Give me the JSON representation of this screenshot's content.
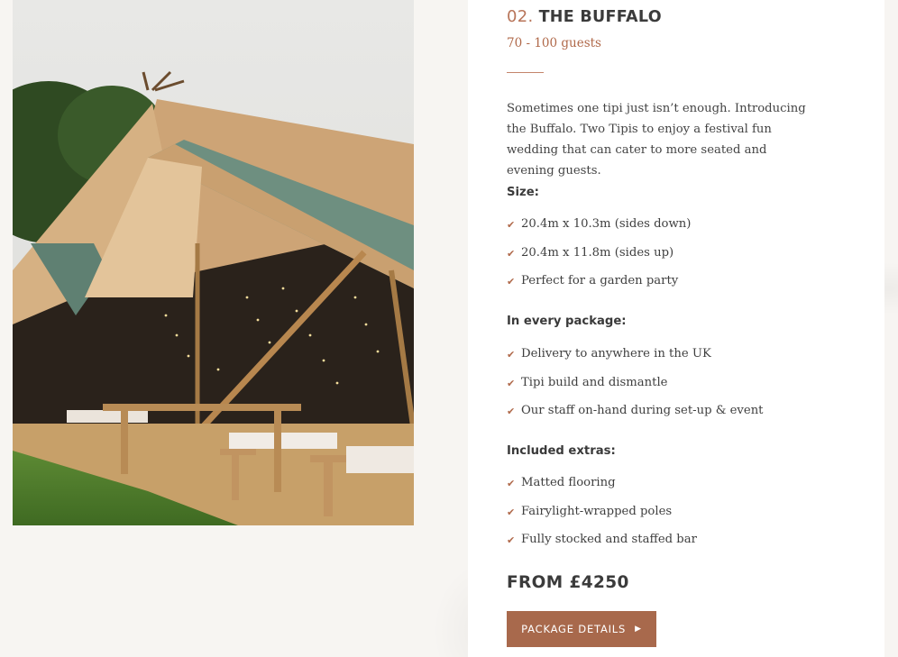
{
  "package": {
    "number": "02.",
    "name": "THE BUFFALO",
    "guests": "70 - 100 guests",
    "description": "Sometimes one tipi just isn’t enough. Introducing the Buffalo. Two Tipis to enjoy a festival fun wedding that can cater to more seated and evening guests.",
    "price": "FROM £4250",
    "button_label": "PACKAGE DETAILS",
    "button_icon": "▶",
    "tick_icon": "✔"
  },
  "sections": [
    {
      "heading": "Size:",
      "items": [
        "20.4m x 10.3m (sides down)",
        "20.4m x 11.8m (sides up)",
        "Perfect for a garden party"
      ]
    },
    {
      "heading": "In every package:",
      "items": [
        "Delivery to anywhere in the UK",
        "Tipi build and dismantle",
        "Our staff on-hand during set-up & event"
      ]
    },
    {
      "heading": "Included extras:",
      "items": [
        "Matted flooring",
        "Fairylight-wrapped poles",
        "Fully stocked and staffed bar"
      ]
    }
  ],
  "colors": {
    "accent": "#b0694a",
    "button": "#a8694c",
    "canvas": "#d2ad7c",
    "flap": "#6e8f80"
  }
}
